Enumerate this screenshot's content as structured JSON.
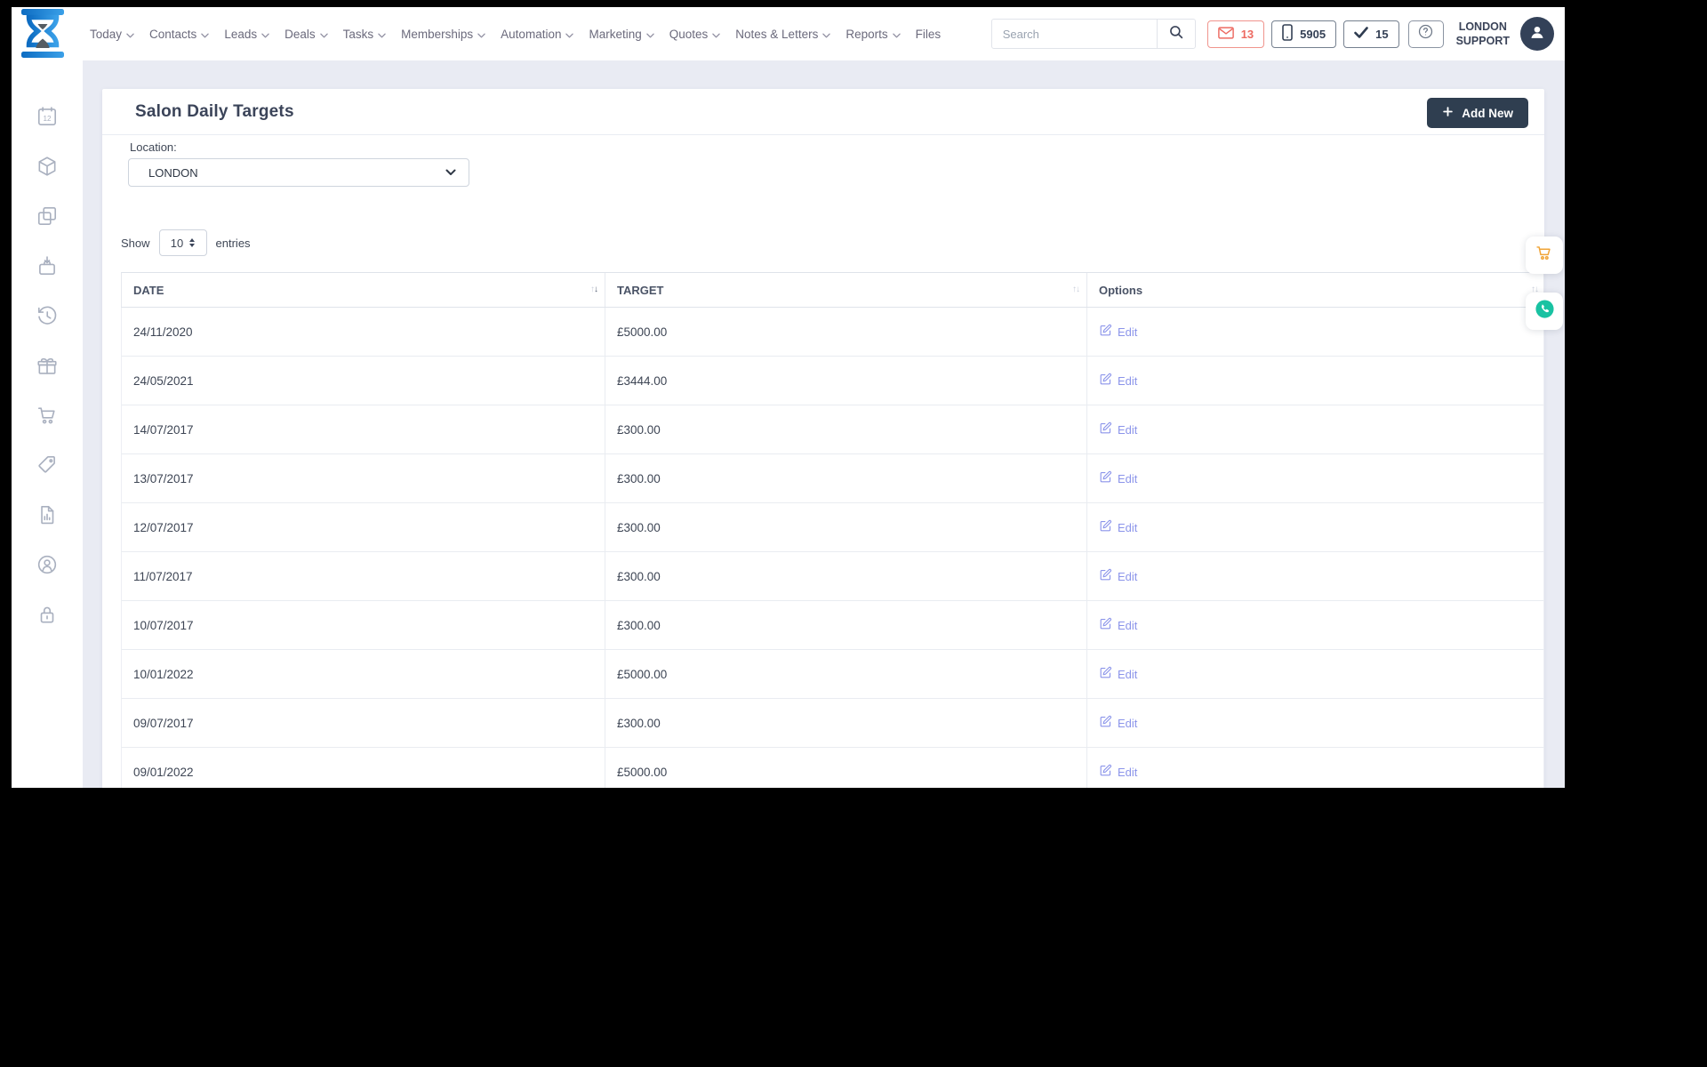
{
  "topbar": {
    "nav_items": [
      {
        "label": "Today",
        "chevron": true
      },
      {
        "label": "Contacts",
        "chevron": true
      },
      {
        "label": "Leads",
        "chevron": true
      },
      {
        "label": "Deals",
        "chevron": true
      },
      {
        "label": "Tasks",
        "chevron": true
      },
      {
        "label": "Memberships",
        "chevron": true
      },
      {
        "label": "Automation",
        "chevron": true
      },
      {
        "label": "Marketing",
        "chevron": true
      },
      {
        "label": "Quotes",
        "chevron": true
      },
      {
        "label": "Notes & Letters",
        "chevron": true
      },
      {
        "label": "Reports",
        "chevron": true
      },
      {
        "label": "Files",
        "chevron": false
      }
    ],
    "search": {
      "placeholder": "Search"
    },
    "badges": {
      "messages": "13",
      "phone": "5905",
      "tasks": "15"
    },
    "user": {
      "line1": "LONDON",
      "line2": "SUPPORT"
    }
  },
  "sidebar": {
    "items": [
      {
        "icon": "calendar-12-icon"
      },
      {
        "icon": "package-icon"
      },
      {
        "icon": "copy-squares-icon"
      },
      {
        "icon": "bag-download-icon"
      },
      {
        "icon": "history-icon"
      },
      {
        "icon": "gift-icon"
      },
      {
        "icon": "trolley-icon"
      },
      {
        "icon": "price-tags-icon"
      },
      {
        "icon": "report-document-icon"
      },
      {
        "icon": "user-circle-icon"
      },
      {
        "icon": "lock-icon"
      }
    ]
  },
  "page": {
    "title": "Salon Daily Targets",
    "add_new_label": "Add New",
    "location_label": "Location:",
    "location_value": "LONDON",
    "show_label": "Show",
    "show_value": "10",
    "entries_label": "entries"
  },
  "table": {
    "columns": [
      {
        "label": "DATE",
        "sort": "desc"
      },
      {
        "label": "TARGET",
        "sort": "none"
      },
      {
        "label": "Options",
        "sort": "none"
      }
    ],
    "edit_label": "Edit",
    "rows": [
      {
        "date": "24/11/2020",
        "target": "£5000.00"
      },
      {
        "date": "24/05/2021",
        "target": "£3444.00"
      },
      {
        "date": "14/07/2017",
        "target": "£300.00"
      },
      {
        "date": "13/07/2017",
        "target": "£300.00"
      },
      {
        "date": "12/07/2017",
        "target": "£300.00"
      },
      {
        "date": "11/07/2017",
        "target": "£300.00"
      },
      {
        "date": "10/07/2017",
        "target": "£300.00"
      },
      {
        "date": "10/01/2022",
        "target": "£5000.00"
      },
      {
        "date": "09/07/2017",
        "target": "£300.00"
      },
      {
        "date": "09/01/2022",
        "target": "£5000.00"
      }
    ]
  },
  "colors": {
    "accent_dark": "#2f3e50",
    "danger": "#ed6a61",
    "edit_link": "#8b94ea",
    "cart_orange": "#f0a437",
    "call_green": "#19c2a2",
    "page_bg": "#e9ebf3"
  }
}
